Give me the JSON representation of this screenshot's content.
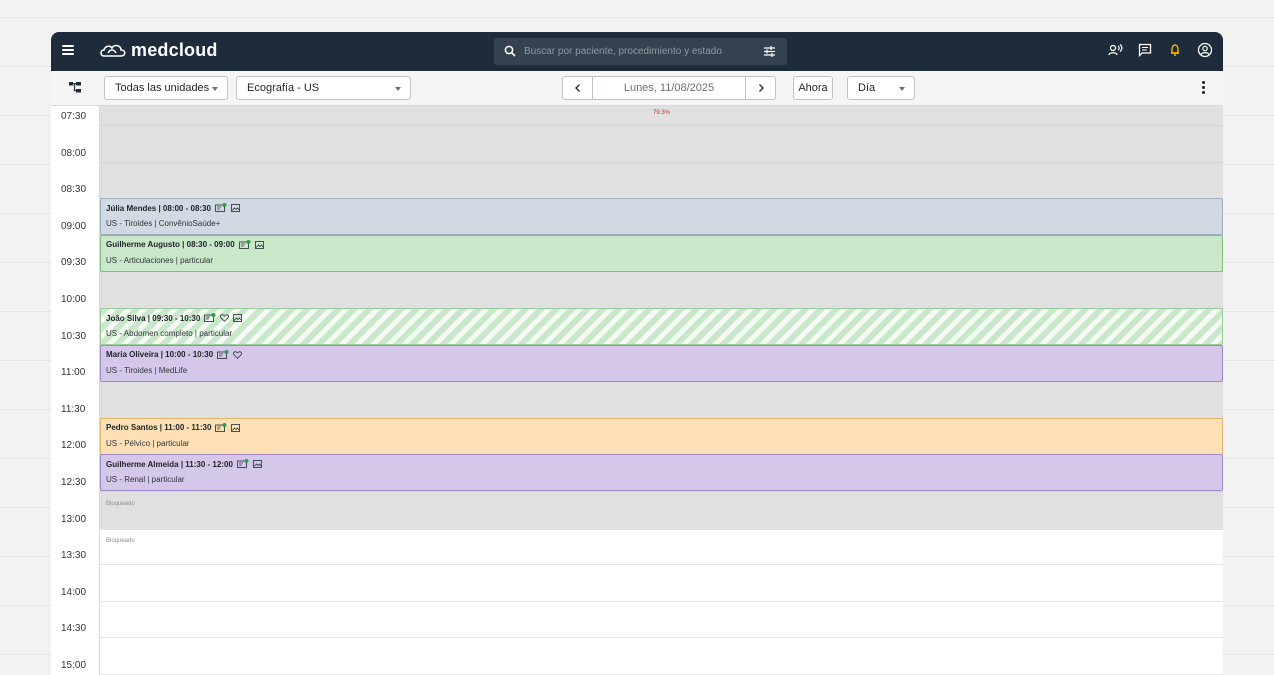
{
  "header": {
    "app_name": "medcloud",
    "search_placeholder": "Buscar por paciente, procedimiento y estado",
    "colors": {
      "bar": "#1d2b3a",
      "bell": "#f5b800"
    }
  },
  "toolbar": {
    "units_select": "Todas las unidades",
    "procedure_select": "Ecografía - US",
    "date": "Lunes, 11/08/2025",
    "now_button": "Ahora",
    "view_select": "Día"
  },
  "calendar": {
    "occupancy": "79.3%",
    "times": [
      "07:30",
      "08:00",
      "08:30",
      "09:00",
      "09:30",
      "10:00",
      "10:30",
      "11:00",
      "11:30",
      "12:00",
      "12:30",
      "13:00",
      "13:30",
      "14:00",
      "14:30",
      "15:00"
    ],
    "appointments": [
      {
        "title": "Júlia Mendes | 08:00 - 08:30",
        "detail": "US - Tiroides | ConvênioSaúde+",
        "color": "#d1dae2",
        "border": "#9db0c0",
        "icons": [
          "monitor-check",
          "image"
        ]
      },
      {
        "title": "Guilherme Augusto  | 08:30 - 09:00",
        "detail": "US - Articulaciones | particular",
        "color": "#c9e7c9",
        "border": "#7fbf7f",
        "icons": [
          "monitor-check",
          "image"
        ]
      },
      {
        "title": "João Silva | 09:30 - 10:30",
        "detail": "US - Abdomen completo | particular",
        "color": "striped",
        "border": "#9ccc9c",
        "icons": [
          "monitor-check",
          "heart",
          "image"
        ]
      },
      {
        "title": "Maria Oliveira | 10:00 - 10:30",
        "detail": "US - Tiroides | MedLife",
        "color": "#d4c7ea",
        "border": "#9e88c9",
        "icons": [
          "monitor-check",
          "heart"
        ]
      },
      {
        "title": "Pedro Santos | 11:00 - 11:30",
        "detail": "US - Pélvico | particular",
        "color": "#fde0b6",
        "border": "#e3b46a",
        "icons": [
          "monitor-check",
          "image"
        ]
      },
      {
        "title": "Guilherme Almeida | 11:30 - 12:00",
        "detail": "US - Renal | particular",
        "color": "#d4c7ea",
        "border": "#9e88c9",
        "icons": [
          "monitor-check",
          "image"
        ]
      }
    ],
    "blocked": [
      "Bloqueado",
      "Bloqueado"
    ]
  }
}
